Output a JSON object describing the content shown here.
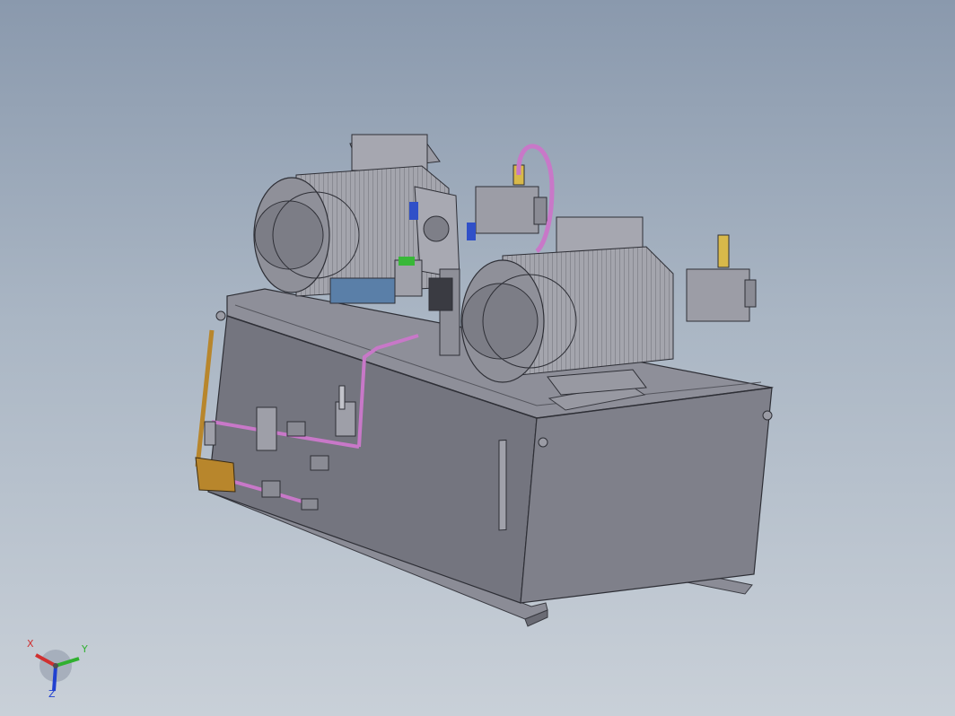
{
  "viewport": {
    "background_top": "#8a99ad",
    "background_bottom": "#c9d0d8"
  },
  "model": {
    "tank_color": "#7a7c88",
    "motor_color": "#8e8f98",
    "pipe_color": "#c878c8",
    "handle_color": "#b8862c"
  },
  "triad": {
    "x_label": "X",
    "y_label": "Y",
    "z_label": "Z",
    "x_color": "#d03030",
    "y_color": "#30b030",
    "z_color": "#2040d0"
  }
}
